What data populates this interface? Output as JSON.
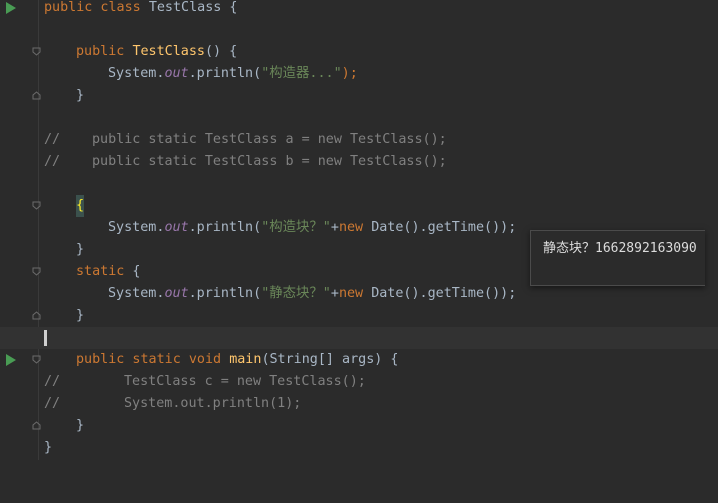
{
  "lines": {
    "l1": {
      "kw": "public class ",
      "name": "TestClass",
      "rest": " {"
    },
    "l3": {
      "kw": "public ",
      "fn": "TestClass",
      "rest": "() {"
    },
    "l4": {
      "pre": "System.",
      "fld": "out",
      "mid": ".println(",
      "str": "\"构造器...\"",
      "end": ");"
    },
    "l5": {
      "text": "}"
    },
    "l7": {
      "mark": "//",
      "text": "public static TestClass a = new TestClass();"
    },
    "l8": {
      "mark": "//",
      "text": "public static TestClass b = new TestClass();"
    },
    "l10": {
      "text": "{"
    },
    "l11": {
      "pre": "System.",
      "fld": "out",
      "mid": ".println(",
      "str": "\"构造块？\"",
      "plus": "+",
      "kwnew": "new ",
      "end": "Date().getTime());"
    },
    "l12": {
      "text": "}"
    },
    "l13": {
      "kw": "static",
      "rest": " {"
    },
    "l14": {
      "pre": "System.",
      "fld": "out",
      "mid": ".println(",
      "str": "\"静态块？\"",
      "plus": "+",
      "kwnew": "new ",
      "end": "Date().getTime());"
    },
    "l15": {
      "text": "}"
    },
    "l17": {
      "kw": "public static void ",
      "fn": "main",
      "rest": "(String[] args) {"
    },
    "l18": {
      "mark": "//",
      "text": "TestClass c = new TestClass();"
    },
    "l19": {
      "mark": "//",
      "text": "System.out.println(1);"
    },
    "l20": {
      "text": "}"
    },
    "l21": {
      "text": "}"
    }
  },
  "console": {
    "output": "静态块？1662892163090"
  },
  "icons": {
    "run": "run-arrow-icon",
    "fold": "fold-marker-icon"
  },
  "colors": {
    "background": "#2b2b2b",
    "keyword": "#cc7832",
    "function": "#ffc66d",
    "string": "#6a8759",
    "field": "#9876aa",
    "comment": "#808080",
    "run": "#499c54"
  }
}
